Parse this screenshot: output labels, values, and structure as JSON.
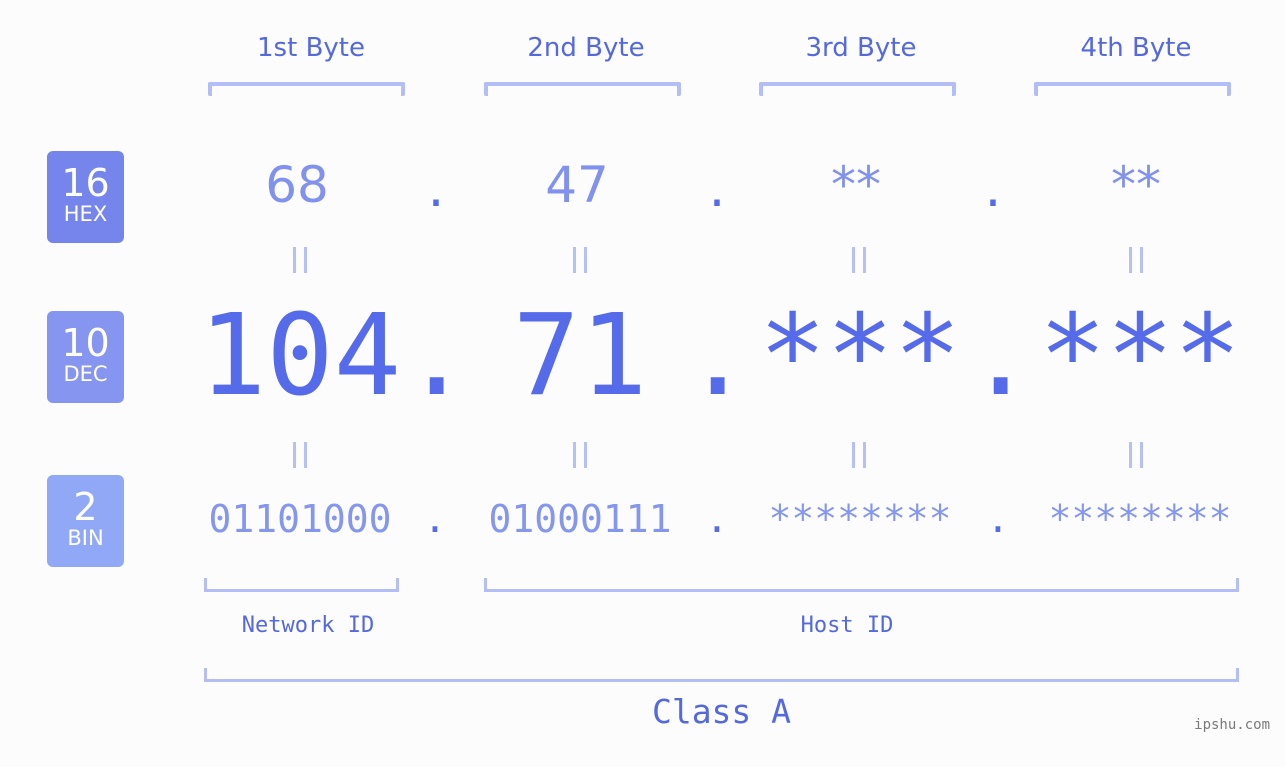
{
  "byte_headers": [
    "1st Byte",
    "2nd Byte",
    "3rd Byte",
    "4th Byte"
  ],
  "badges": {
    "hex": {
      "number": "16",
      "label": "HEX",
      "color": "#7585ec"
    },
    "dec": {
      "number": "10",
      "label": "DEC",
      "color": "#8595f0"
    },
    "bin": {
      "number": "2",
      "label": "BIN",
      "color": "#91a8f7"
    }
  },
  "hex_values": [
    "68",
    "47",
    "**",
    "**"
  ],
  "dec_values": [
    "104",
    "71",
    "***",
    "***"
  ],
  "bin_values": [
    "01101000",
    "01000111",
    "********",
    "********"
  ],
  "separator": ".",
  "equals_symbol": "=",
  "network_id_label": "Network ID",
  "host_id_label": "Host ID",
  "class_label": "Class A",
  "watermark": "ipshu.com",
  "colors": {
    "accent": "#566be9",
    "bracket": "#b3bdf6",
    "hex_text": "#8191ee",
    "bin_text": "#8596ee"
  }
}
